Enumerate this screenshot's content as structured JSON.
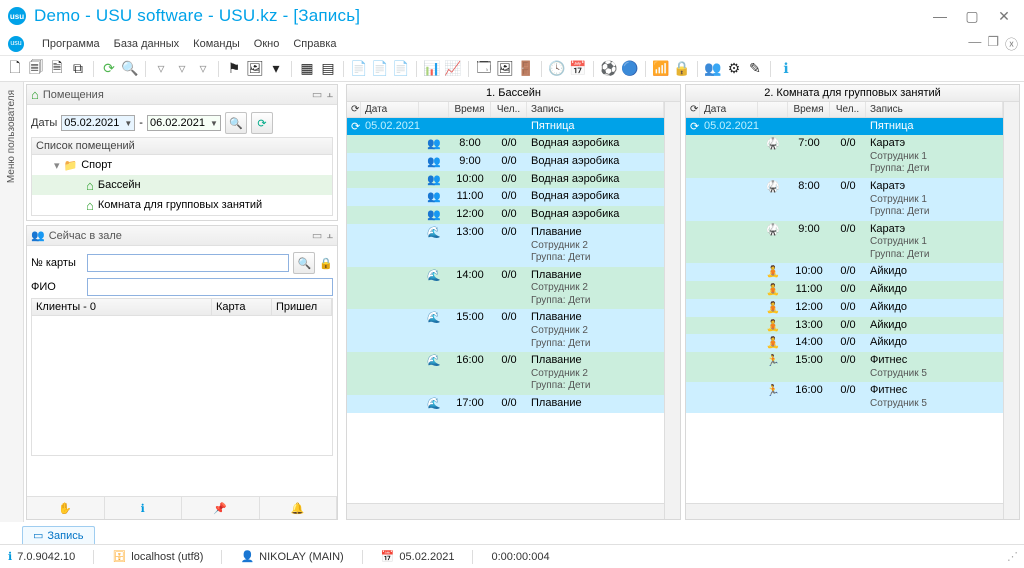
{
  "window": {
    "title": "Demo - USU software - USU.kz - [Запись]"
  },
  "menu": {
    "items": [
      "Программа",
      "База данных",
      "Команды",
      "Окно",
      "Справка"
    ]
  },
  "vtab": {
    "label": "Меню пользователя"
  },
  "panels": {
    "rooms": {
      "title": "Помещения",
      "dates_label": "Даты",
      "date_from": "05.02.2021",
      "date_to": "06.02.2021",
      "list_title": "Список помещений",
      "tree": {
        "root": "Спорт",
        "children": [
          "Бассейн",
          "Комната для групповых занятий"
        ]
      }
    },
    "now": {
      "title": "Сейчас в зале",
      "card_label": "№ карты",
      "fio_label": "ФИО",
      "card_value": "",
      "fio_value": "",
      "clients_header": "Клиенты - 0",
      "col_card": "Карта",
      "col_arrived": "Пришел"
    }
  },
  "schedules": [
    {
      "title": "1. Бассейн",
      "cols": {
        "date": "Дата",
        "time": "Время",
        "ppl": "Чел..",
        "rec": "Запись"
      },
      "day": {
        "date": "05.02.2021",
        "name": "Пятница"
      },
      "rows": [
        {
          "ico": "👥",
          "time": "8:00",
          "ppl": "0/0",
          "lines": [
            "Водная аэробика"
          ],
          "cls": "green"
        },
        {
          "ico": "👥",
          "time": "9:00",
          "ppl": "0/0",
          "lines": [
            "Водная аэробика"
          ],
          "cls": "blue"
        },
        {
          "ico": "👥",
          "time": "10:00",
          "ppl": "0/0",
          "lines": [
            "Водная аэробика"
          ],
          "cls": "green"
        },
        {
          "ico": "👥",
          "time": "11:00",
          "ppl": "0/0",
          "lines": [
            "Водная аэробика"
          ],
          "cls": "blue"
        },
        {
          "ico": "👥",
          "time": "12:00",
          "ppl": "0/0",
          "lines": [
            "Водная аэробика"
          ],
          "cls": "green"
        },
        {
          "ico": "🌊",
          "time": "13:00",
          "ppl": "0/0",
          "lines": [
            "Плавание",
            "Сотрудник 2",
            "Группа: Дети"
          ],
          "cls": "blue"
        },
        {
          "ico": "🌊",
          "time": "14:00",
          "ppl": "0/0",
          "lines": [
            "Плавание",
            "Сотрудник 2",
            "Группа: Дети"
          ],
          "cls": "green"
        },
        {
          "ico": "🌊",
          "time": "15:00",
          "ppl": "0/0",
          "lines": [
            "Плавание",
            "Сотрудник 2",
            "Группа: Дети"
          ],
          "cls": "blue"
        },
        {
          "ico": "🌊",
          "time": "16:00",
          "ppl": "0/0",
          "lines": [
            "Плавание",
            "Сотрудник 2",
            "Группа: Дети"
          ],
          "cls": "green"
        },
        {
          "ico": "🌊",
          "time": "17:00",
          "ppl": "0/0",
          "lines": [
            "Плавание"
          ],
          "cls": "blue"
        }
      ]
    },
    {
      "title": "2. Комната для групповых занятий",
      "cols": {
        "date": "Дата",
        "time": "Время",
        "ppl": "Чел..",
        "rec": "Запись"
      },
      "day": {
        "date": "05.02.2021",
        "name": "Пятница"
      },
      "rows": [
        {
          "ico": "🥋",
          "time": "7:00",
          "ppl": "0/0",
          "lines": [
            "Каратэ",
            "Сотрудник 1",
            "Группа: Дети"
          ],
          "cls": "green"
        },
        {
          "ico": "🥋",
          "time": "8:00",
          "ppl": "0/0",
          "lines": [
            "Каратэ",
            "Сотрудник 1",
            "Группа: Дети"
          ],
          "cls": "blue"
        },
        {
          "ico": "🥋",
          "time": "9:00",
          "ppl": "0/0",
          "lines": [
            "Каратэ",
            "Сотрудник 1",
            "Группа: Дети"
          ],
          "cls": "green"
        },
        {
          "ico": "🧘",
          "time": "10:00",
          "ppl": "0/0",
          "lines": [
            "Айкидо"
          ],
          "cls": "blue"
        },
        {
          "ico": "🧘",
          "time": "11:00",
          "ppl": "0/0",
          "lines": [
            "Айкидо"
          ],
          "cls": "green"
        },
        {
          "ico": "🧘",
          "time": "12:00",
          "ppl": "0/0",
          "lines": [
            "Айкидо"
          ],
          "cls": "blue"
        },
        {
          "ico": "🧘",
          "time": "13:00",
          "ppl": "0/0",
          "lines": [
            "Айкидо"
          ],
          "cls": "green"
        },
        {
          "ico": "🧘",
          "time": "14:00",
          "ppl": "0/0",
          "lines": [
            "Айкидо"
          ],
          "cls": "blue"
        },
        {
          "ico": "🏃",
          "time": "15:00",
          "ppl": "0/0",
          "lines": [
            "Фитнес",
            "Сотрудник 5"
          ],
          "cls": "green"
        },
        {
          "ico": "🏃",
          "time": "16:00",
          "ppl": "0/0",
          "lines": [
            "Фитнес",
            "Сотрудник 5"
          ],
          "cls": "blue"
        }
      ]
    }
  ],
  "bottom_tab": "Запись",
  "status": {
    "version": "7.0.9042.10",
    "host": "localhost (utf8)",
    "user": "NIKOLAY (MAIN)",
    "date": "05.02.2021",
    "time": "0:00:00:004"
  }
}
